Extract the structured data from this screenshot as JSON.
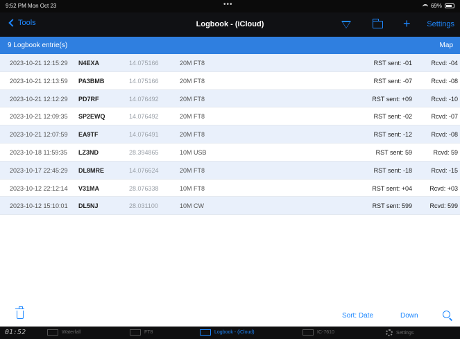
{
  "status": {
    "time": "9:52 PM  Mon Oct 23",
    "dots": "•••",
    "battery": "69%"
  },
  "nav": {
    "back_label": "Tools",
    "title": "Logbook - (iCloud)",
    "settings_label": "Settings",
    "plus": "+"
  },
  "header": {
    "count": "9 Logbook entrie(s)",
    "map_label": "Map"
  },
  "entries": [
    {
      "date": "2023-10-21 12:15:29",
      "call": "N4EXA",
      "freq": "14.075166",
      "mode": "20M FT8",
      "sent": "RST sent: -01",
      "rcvd": "Rcvd: -04"
    },
    {
      "date": "2023-10-21 12:13:59",
      "call": "PA3BMB",
      "freq": "14.075166",
      "mode": "20M FT8",
      "sent": "RST sent: -07",
      "rcvd": "Rcvd: -08"
    },
    {
      "date": "2023-10-21 12:12:29",
      "call": "PD7RF",
      "freq": "14.076492",
      "mode": "20M FT8",
      "sent": "RST sent: +09",
      "rcvd": "Rcvd: -10"
    },
    {
      "date": "2023-10-21 12:09:35",
      "call": "SP2EWQ",
      "freq": "14.076492",
      "mode": "20M FT8",
      "sent": "RST sent: -02",
      "rcvd": "Rcvd: -07"
    },
    {
      "date": "2023-10-21 12:07:59",
      "call": "EA9TF",
      "freq": "14.076491",
      "mode": "20M FT8",
      "sent": "RST sent: -12",
      "rcvd": "Rcvd: -08"
    },
    {
      "date": "2023-10-18 11:59:35",
      "call": "LZ3ND",
      "freq": "28.394865",
      "mode": "10M USB",
      "sent": "RST sent: 59",
      "rcvd": "Rcvd: 59"
    },
    {
      "date": "2023-10-17 22:45:29",
      "call": "DL8MRE",
      "freq": "14.076624",
      "mode": "20M FT8",
      "sent": "RST sent: -18",
      "rcvd": "Rcvd: -15"
    },
    {
      "date": "2023-10-12 22:12:14",
      "call": "V31MA",
      "freq": "28.076338",
      "mode": "10M FT8",
      "sent": "RST sent: +04",
      "rcvd": "Rcvd: +03"
    },
    {
      "date": "2023-10-12 15:10:01",
      "call": "DL5NJ",
      "freq": "28.031100",
      "mode": "10M CW",
      "sent": "RST sent: 599",
      "rcvd": "Rcvd: 599"
    }
  ],
  "toolbar": {
    "sort_label": "Sort: Date",
    "direction_label": "Down"
  },
  "tabbar": {
    "clock": "01:52",
    "tabs": [
      {
        "label": "Waterfall",
        "active": false
      },
      {
        "label": "FT8",
        "active": false
      },
      {
        "label": "Logbook - (iCloud)",
        "active": true
      },
      {
        "label": "IC-7610",
        "active": false
      },
      {
        "label": "Settings",
        "active": false
      }
    ]
  },
  "colors": {
    "accent": "#1e88ff",
    "header": "#2f7fe0",
    "row_alt": "#e9f0fb",
    "nav_bg": "#101114"
  }
}
